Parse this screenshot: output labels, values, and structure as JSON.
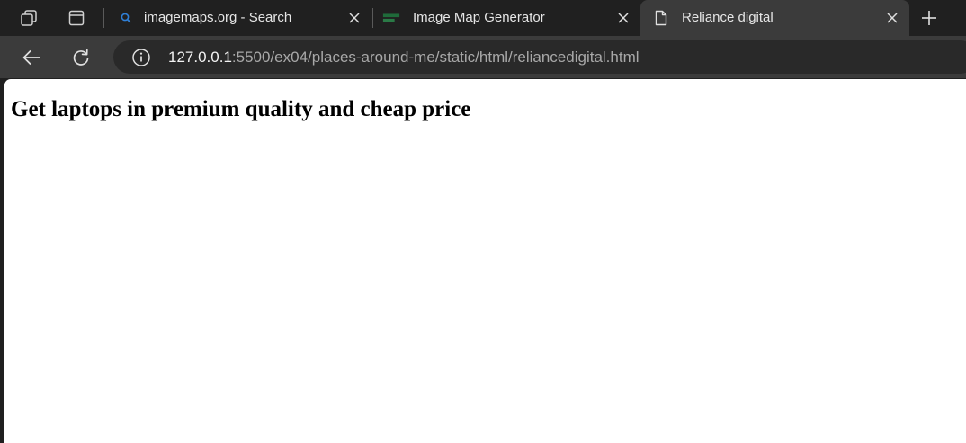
{
  "tabs": [
    {
      "title": "imagemaps.org - Search",
      "icon": "search-icon",
      "active": false
    },
    {
      "title": "Image Map Generator",
      "icon": "image-map-favicon",
      "active": false
    },
    {
      "title": "Reliance digital",
      "icon": "page-icon",
      "active": true
    }
  ],
  "address_bar": {
    "host": "127.0.0.1",
    "path": ":5500/ex04/places-around-me/static/html/reliancedigital.html"
  },
  "page": {
    "heading": "Get laptops in premium quality and cheap price"
  },
  "colors": {
    "tabstrip_bg": "#202020",
    "active_tab_bg": "#3b3b3b",
    "omnibox_bg": "#292929",
    "page_bg": "#ffffff"
  }
}
